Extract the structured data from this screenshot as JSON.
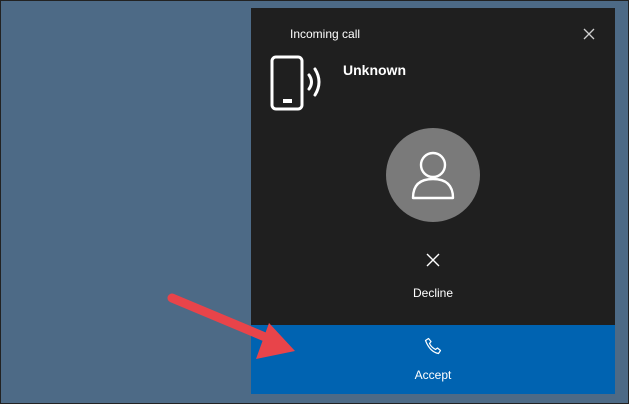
{
  "toast": {
    "title": "Incoming call",
    "caller_name": "Unknown",
    "decline_label": "Decline",
    "accept_label": "Accept"
  },
  "icons": {
    "close": "close-icon",
    "device": "phone-ringing-icon",
    "avatar": "person-icon",
    "decline": "close-icon",
    "accept": "phone-handset-icon"
  },
  "colors": {
    "desktop_background": "#4d6a86",
    "toast_background": "#1f1f1f",
    "avatar_background": "#7a7a7a",
    "accept_background": "#0063b1",
    "arrow": "#e8444a"
  }
}
